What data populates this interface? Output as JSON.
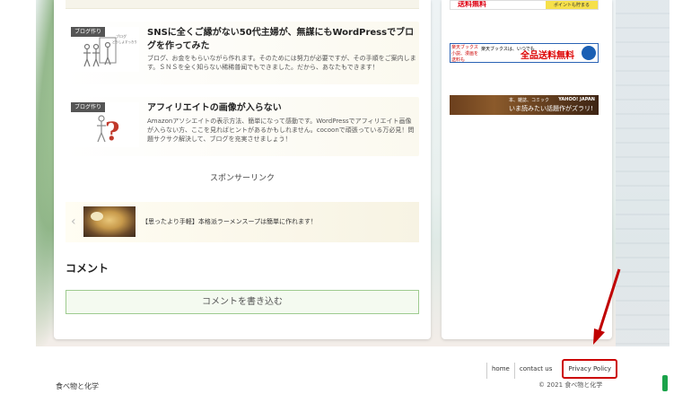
{
  "articles": [
    {
      "category": "ブログ作り",
      "title": "SNSに全くご縁がない50代主婦が、無謀にもWordPressでブログを作ってみた",
      "snippet": "ブログ、お金をもらいながら作れます。そのためには努力が必要ですが、その手順をご案内します。ＳＮＳを全く知らない稀稀普闻でもできました。だから、あなたもできます！",
      "thumb_label": "ブログ どうしよ すっきりさせたい"
    },
    {
      "category": "ブログ作り",
      "title": "アフィリエイトの画像が入らない",
      "snippet": "Amazonアソシエイトの表示方法、簡単になって感動です。WordPressでアフィリエイト画像が入らない方、ここを見ればヒントがあるかもしれません。cocoonで頑張っている万必見！問題サクサク解決して、ブログを充実させましょう！"
    }
  ],
  "sponsor_label": "スポンサーリンク",
  "prev_post": {
    "text": "【思ったより手軽】本格派ラーメンスープは簡単に作れます！"
  },
  "comment": {
    "heading": "コメント",
    "button": "コメントを書き込む"
  },
  "ads": {
    "ad1_text": "送料無料",
    "ad1_side": "ポイントも貯まる",
    "ad2_left": "楽天ブックス 小説、漫画を送料も",
    "ad2_mid": "楽天ブックスは、いつでも",
    "ad2_big": "全品送料無料",
    "ad3_small": "本、雑誌、コミック",
    "ad3_text": "いま読みたい話題作がズラリ!",
    "ad3_brand": "YAHOO! JAPAN"
  },
  "footer": {
    "links": [
      "home",
      "contact us",
      "Privacy Policy"
    ],
    "site_name": "食べ物と化学",
    "copyright": "© 2021 食べ物と化学"
  },
  "colors": {
    "highlight_red": "#c00000",
    "comment_border": "#9ecb8f",
    "green_tab": "#1aa34a"
  }
}
